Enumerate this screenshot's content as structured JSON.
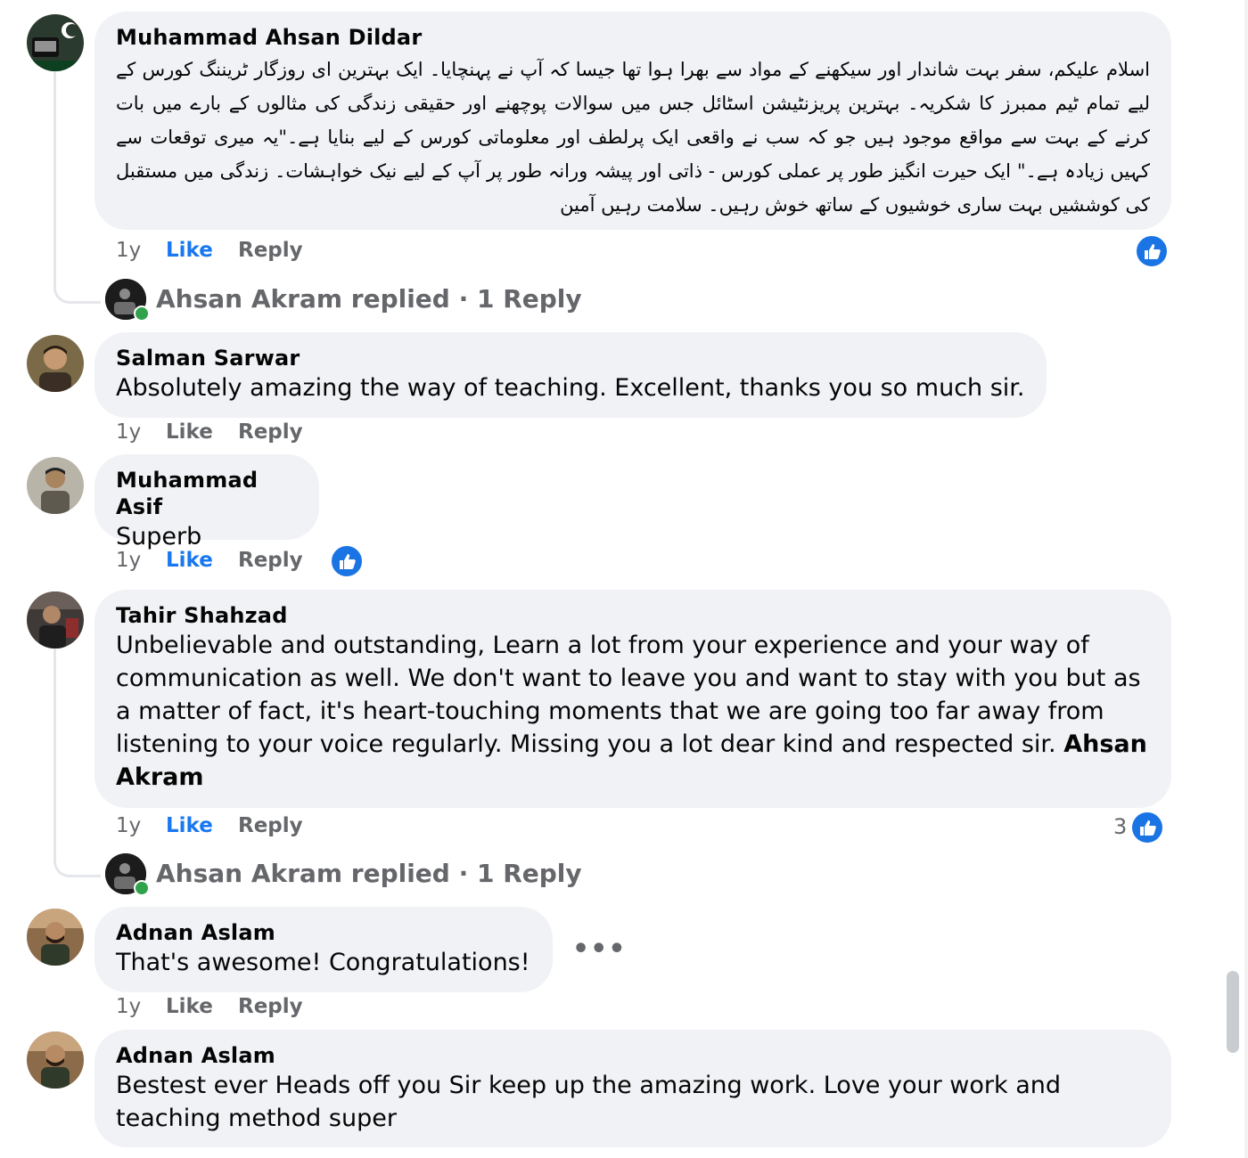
{
  "comments": [
    {
      "author": "Muhammad Ahsan Dildar",
      "text": "اسلام علیکم، سفر بہت شاندار اور سیکھنے کے مواد سے بھرا ہوا تھا جیسا کہ آپ نے پہنچایا۔ ایک بہترین ای روزگار ٹریننگ کورس کے لیے تمام ٹیم ممبرز کا شکریہ۔ بہترین پریزنٹیشن اسٹائل جس میں سوالات پوچھنے اور حقیقی زندگی کی مثالوں کے بارے میں بات کرنے کے بہت سے مواقع موجود ہیں جو کہ سب نے واقعی ایک پرلطف اور معلوماتی کورس کے لیے بنایا ہے۔\"یہ میری توقعات سے کہیں زیادہ ہے۔\" ایک حیرت انگیز طور پر عملی کورس - ذاتی اور پیشہ ورانہ طور پر آپ کے لیے نیک خواہشات۔ زندگی میں مستقبل کی کوششیں بہت ساری خوشیوں کے ساتھ خوش رہیں۔ سلامت رہیں آمین",
      "time": "1y",
      "like": "Like",
      "reply": "Reply"
    },
    {
      "author": "Salman Sarwar",
      "text": "Absolutely amazing the way of teaching. Excellent, thanks you so much sir.",
      "time": "1y",
      "like": "Like",
      "reply": "Reply"
    },
    {
      "author": "Muhammad Asif",
      "text": "Superb",
      "time": "1y",
      "like": "Like",
      "reply": "Reply"
    },
    {
      "author": "Tahir Shahzad",
      "text": "Unbelievable and outstanding, Learn a lot from your experience and your way of communication as well. We don't want to leave you and want to stay with you but as a matter of fact, it's heart-touching moments that we are going too far away from listening to your voice regularly. Missing you a lot dear kind and respected sir.",
      "mention": "Ahsan Akram",
      "time": "1y",
      "like": "Like",
      "reply": "Reply",
      "reaction_count": "3"
    },
    {
      "author": "Adnan Aslam",
      "text": "That's awesome! Congratulations!",
      "time": "1y",
      "like": "Like",
      "reply": "Reply",
      "more": "•••"
    },
    {
      "author": "Adnan Aslam",
      "text": "Bestest ever Heads off you Sir keep up the amazing work. Love your work and teaching method super"
    }
  ],
  "replies": [
    {
      "label": "Ahsan Akram replied · 1 Reply"
    },
    {
      "label": "Ahsan Akram replied · 1 Reply"
    }
  ],
  "colors": {
    "bubble": "#f0f2f5",
    "link_blue": "#1877f2",
    "reaction_blue": "#1b74e4",
    "muted": "#65676b",
    "online": "#31a24c"
  },
  "icons": {
    "reaction": "thumbs-up-icon",
    "more": "more-options-icon"
  }
}
